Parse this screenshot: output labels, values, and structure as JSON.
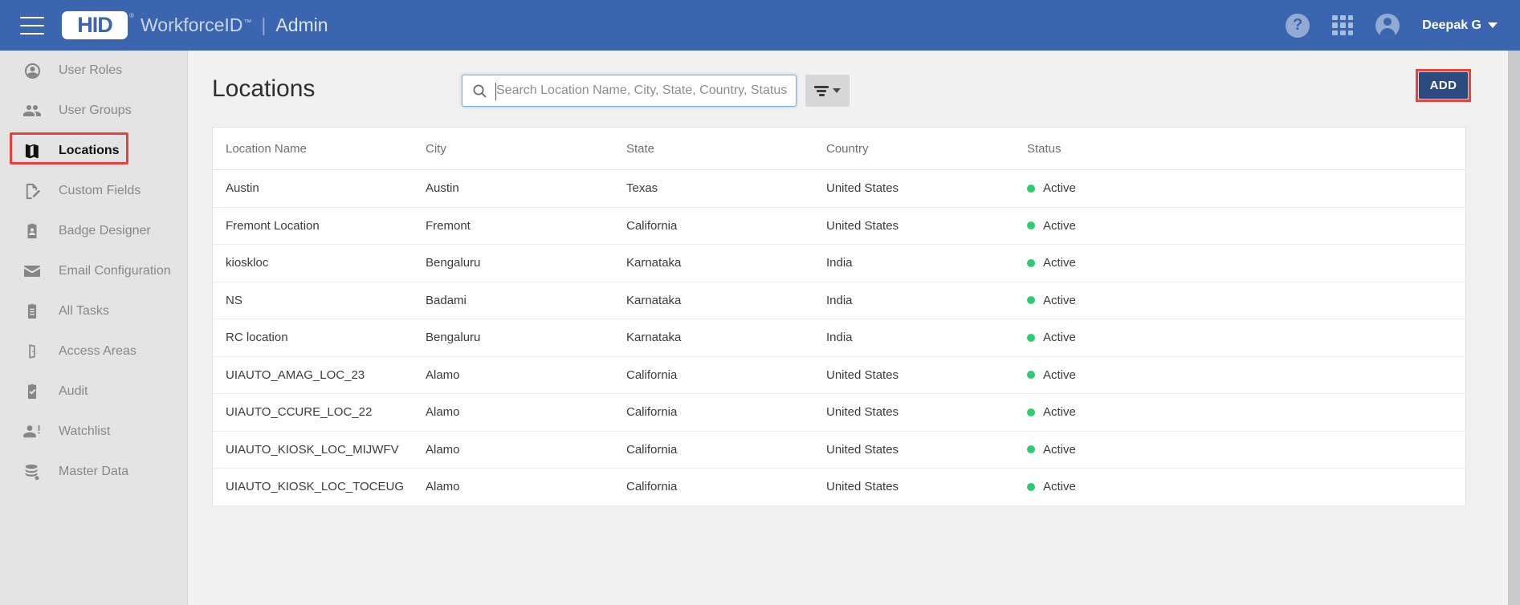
{
  "header": {
    "menu_icon": "hamburger-icon",
    "logo_text": "HID",
    "logo_reg": "®",
    "product": "WorkforceID",
    "product_tm": "™",
    "divider": "|",
    "section": "Admin",
    "help_icon": "?",
    "apps_icon": "apps-grid-icon",
    "account_icon": "account-circle-icon",
    "username": "Deepak G"
  },
  "sidebar": {
    "items": [
      {
        "label": "User Roles",
        "icon": "user-circle-icon",
        "active": false
      },
      {
        "label": "User Groups",
        "icon": "user-group-icon",
        "active": false
      },
      {
        "label": "Locations",
        "icon": "map-icon",
        "active": true
      },
      {
        "label": "Custom Fields",
        "icon": "edit-document-icon",
        "active": false
      },
      {
        "label": "Badge Designer",
        "icon": "badge-icon",
        "active": false
      },
      {
        "label": "Email Configuration",
        "icon": "envelope-icon",
        "active": false
      },
      {
        "label": "All Tasks",
        "icon": "clipboard-list-icon",
        "active": false
      },
      {
        "label": "Access Areas",
        "icon": "door-icon",
        "active": false
      },
      {
        "label": "Audit",
        "icon": "clipboard-check-icon",
        "active": false
      },
      {
        "label": "Watchlist",
        "icon": "user-alert-icon",
        "active": false
      },
      {
        "label": "Master Data",
        "icon": "database-icon",
        "active": false
      }
    ]
  },
  "main": {
    "page_title": "Locations",
    "search": {
      "icon": "search-icon",
      "placeholder": "Search Location Name, City, State, Country, Status",
      "value": ""
    },
    "filter_button": {
      "icon": "filter-icon",
      "caret": "chevron-down-icon"
    },
    "add_button": {
      "label": "ADD"
    },
    "annotations": {
      "color": "#e8423a",
      "targets": [
        "sidebar-item-locations",
        "add-button"
      ]
    }
  },
  "table": {
    "columns": [
      "Location Name",
      "City",
      "State",
      "Country",
      "Status"
    ],
    "rows": [
      {
        "name": "Austin",
        "city": "Austin",
        "state": "Texas",
        "country": "United States",
        "status": "Active"
      },
      {
        "name": "Fremont Location",
        "city": "Fremont",
        "state": "California",
        "country": "United States",
        "status": "Active"
      },
      {
        "name": "kioskloc",
        "city": "Bengaluru",
        "state": "Karnataka",
        "country": "India",
        "status": "Active"
      },
      {
        "name": "NS",
        "city": "Badami",
        "state": "Karnataka",
        "country": "India",
        "status": "Active"
      },
      {
        "name": "RC location",
        "city": "Bengaluru",
        "state": "Karnataka",
        "country": "India",
        "status": "Active"
      },
      {
        "name": "UIAUTO_AMAG_LOC_23",
        "city": "Alamo",
        "state": "California",
        "country": "United States",
        "status": "Active"
      },
      {
        "name": "UIAUTO_CCURE_LOC_22",
        "city": "Alamo",
        "state": "California",
        "country": "United States",
        "status": "Active"
      },
      {
        "name": "UIAUTO_KIOSK_LOC_MIJWFV",
        "city": "Alamo",
        "state": "California",
        "country": "United States",
        "status": "Active"
      },
      {
        "name": "UIAUTO_KIOSK_LOC_TOCEUG",
        "city": "Alamo",
        "state": "California",
        "country": "United States",
        "status": "Active"
      }
    ]
  },
  "colors": {
    "header_blue": "#3c65b0",
    "sidebar_bg": "#e4e4e4",
    "content_bg": "#f1f1f1",
    "add_button_blue": "#2b4a80",
    "annotation_red": "#e8423a",
    "status_green": "#2ecc71"
  }
}
